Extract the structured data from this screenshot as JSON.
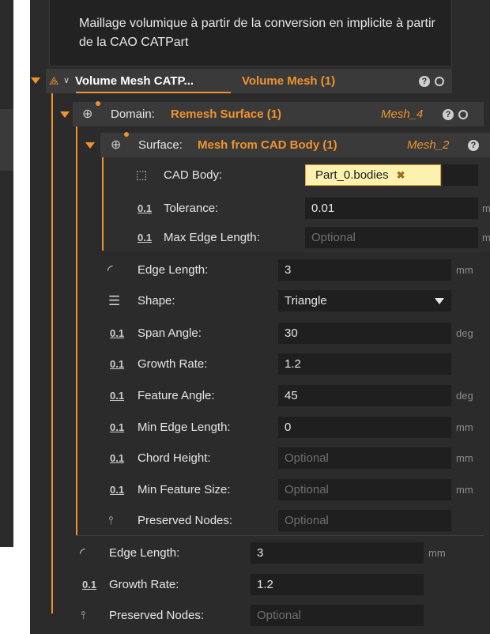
{
  "note_text": "Maillage volumique à partir de la conversion en implicite à partir de la CAO CATPart",
  "volume_mesh": {
    "label": "Volume Mesh CATP...",
    "type": "Volume Mesh (1)"
  },
  "domain": {
    "label": "Domain:",
    "value": "Remesh Surface (1)",
    "ref": "Mesh_4"
  },
  "surface": {
    "label": "Surface:",
    "value": "Mesh from CAD Body (1)",
    "ref": "Mesh_2"
  },
  "surface_fields": {
    "cad_body": {
      "label": "CAD Body:",
      "value": "Part_0.bodies",
      "remove": "✖"
    },
    "tolerance": {
      "label": "Tolerance:",
      "value": "0.01",
      "unit": "m"
    },
    "max_edge": {
      "label": "Max Edge Length:",
      "placeholder": "Optional",
      "unit": "m"
    }
  },
  "domain_fields": {
    "edge_length": {
      "label": "Edge Length:",
      "value": "3",
      "unit": "mm"
    },
    "shape": {
      "label": "Shape:",
      "value": "Triangle"
    },
    "span_angle": {
      "label": "Span Angle:",
      "value": "30",
      "unit": "deg"
    },
    "growth_rate": {
      "label": "Growth Rate:",
      "value": "1.2"
    },
    "feature_angle": {
      "label": "Feature Angle:",
      "value": "45",
      "unit": "deg"
    },
    "min_edge_length": {
      "label": "Min Edge Length:",
      "value": "0",
      "unit": "mm"
    },
    "chord_height": {
      "label": "Chord Height:",
      "placeholder": "Optional",
      "unit": "mm"
    },
    "min_feature_size": {
      "label": "Min Feature Size:",
      "placeholder": "Optional",
      "unit": "mm"
    },
    "preserved_nodes": {
      "label": "Preserved Nodes:",
      "placeholder": "Optional"
    }
  },
  "volume_fields": {
    "edge_length": {
      "label": "Edge Length:",
      "value": "3",
      "unit": "mm"
    },
    "growth_rate": {
      "label": "Growth Rate:",
      "value": "1.2"
    },
    "preserved_nodes": {
      "label": "Preserved Nodes:",
      "placeholder": "Optional"
    }
  },
  "icons": {
    "number": "0.1",
    "help": "?"
  },
  "colors": {
    "accent": "#f0932f",
    "panel": "#2b2b2b",
    "field": "#1f1f1f",
    "chip": "#fbf2b0"
  }
}
